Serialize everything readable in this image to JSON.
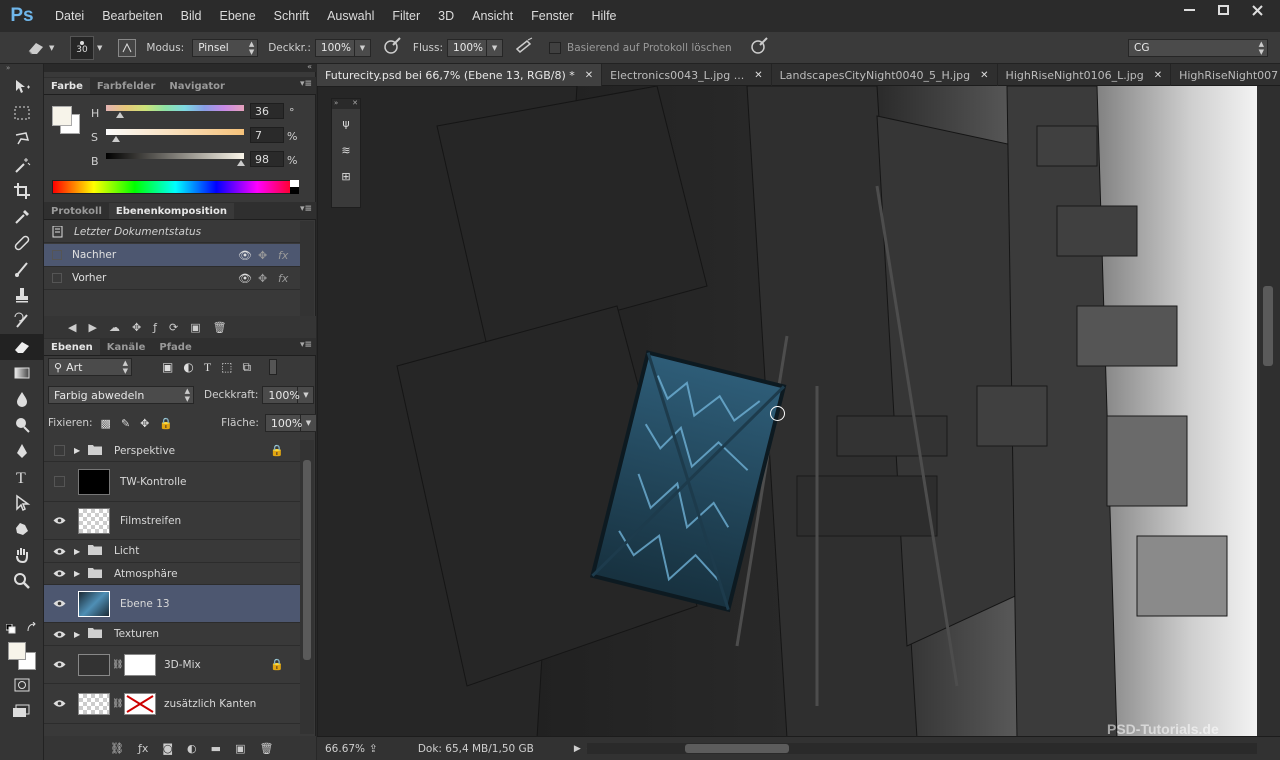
{
  "app": {
    "logo": "Ps"
  },
  "menu": [
    "Datei",
    "Bearbeiten",
    "Bild",
    "Ebene",
    "Schrift",
    "Auswahl",
    "Filter",
    "3D",
    "Ansicht",
    "Fenster",
    "Hilfe"
  ],
  "window_buttons": [
    "minimize-icon",
    "maximize-icon",
    "close-icon"
  ],
  "options_bar": {
    "brush_size": "30",
    "modus_label": "Modus:",
    "modus_value": "Pinsel",
    "deckkr_label": "Deckkr.:",
    "deckkr_value": "100%",
    "fluss_label": "Fluss:",
    "fluss_value": "100%",
    "protokoll_label": "Basierend auf Protokoll löschen",
    "workspace": "CG"
  },
  "color_panel": {
    "tabs": [
      "Farbe",
      "Farbfelder",
      "Navigator"
    ],
    "h_label": "H",
    "h_value": "36",
    "h_unit": "°",
    "s_label": "S",
    "s_value": "7",
    "s_unit": "%",
    "b_label": "B",
    "b_value": "98",
    "b_unit": "%",
    "h_fraction": 0.1,
    "s_fraction": 0.07,
    "b_fraction": 0.98,
    "foreground": "#f7f4ea",
    "background": "#ffffff"
  },
  "composition_panel": {
    "tabs": [
      "Protokoll",
      "Ebenenkomposition"
    ],
    "last_state": "Letzter Dokumentstatus",
    "items": [
      {
        "label": "Nachher",
        "selected": true
      },
      {
        "label": "Vorher",
        "selected": false
      }
    ]
  },
  "layers_panel": {
    "tabs": [
      "Ebenen",
      "Kanäle",
      "Pfade"
    ],
    "filter_kind": "Art",
    "blend_mode": "Farbig abwedeln",
    "opacity_label": "Deckkraft:",
    "opacity_value": "100%",
    "lock_label": "Fixieren:",
    "fill_label": "Fläche:",
    "fill_value": "100%",
    "layers": [
      {
        "name": "Perspektive",
        "type": "group",
        "visible": false,
        "locked": true
      },
      {
        "name": "TW-Kontrolle",
        "type": "layer",
        "visible": false,
        "thumb": "black"
      },
      {
        "name": "Filmstreifen",
        "type": "layer",
        "visible": true,
        "thumb": "transparent"
      },
      {
        "name": "Licht",
        "type": "group",
        "visible": true
      },
      {
        "name": "Atmosphäre",
        "type": "group",
        "visible": true
      },
      {
        "name": "Ebene 13",
        "type": "layer",
        "visible": true,
        "thumb": "image",
        "selected": true
      },
      {
        "name": "Texturen",
        "type": "group",
        "visible": true
      },
      {
        "name": "3D-Mix",
        "type": "masked",
        "visible": true,
        "locked": true
      },
      {
        "name": "zusätzlich Kanten",
        "type": "masked",
        "visible": true
      }
    ]
  },
  "documents": {
    "tabs": [
      {
        "label": "Futurecity.psd bei 66,7% (Ebene 13, RGB/8) *",
        "active": true
      },
      {
        "label": "Electronics0043_L.jpg ...",
        "active": false
      },
      {
        "label": "LandscapesCityNight0040_5_H.jpg",
        "active": false
      },
      {
        "label": "HighRiseNight0106_L.jpg",
        "active": false
      },
      {
        "label": "HighRiseNight007",
        "active": false
      }
    ]
  },
  "status": {
    "zoom": "66.67%",
    "doc_size": "Dok: 65,4 MB/1,50 GB"
  },
  "watermark": "PSD-Tutorials.de"
}
